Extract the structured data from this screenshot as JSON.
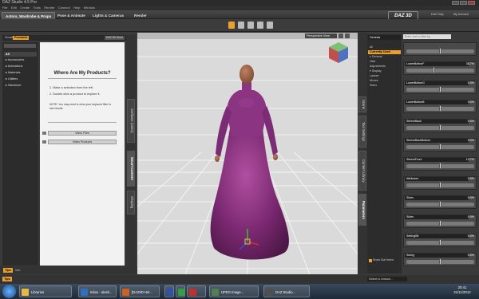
{
  "window": {
    "title": "DAZ Studio 4.5 Pro"
  },
  "menu": [
    "File",
    "Edit",
    "Create",
    "Tools",
    "Render",
    "Connect",
    "Help",
    "Window"
  ],
  "tabs": [
    {
      "label": "Actors, Wardrobe & Props",
      "active": true
    },
    {
      "label": "Pose & Animate",
      "active": false
    },
    {
      "label": "Lights & Cameras",
      "active": false
    },
    {
      "label": "Render",
      "active": false
    }
  ],
  "brand": {
    "logo": "DAZ 3D",
    "links": [
      "DAZ Help",
      "My Account"
    ]
  },
  "left_panel": {
    "tabs": [
      {
        "label": "Smart",
        "active": false
      },
      {
        "label": "Products",
        "active": true
      }
    ],
    "store_button": "DAZ 3D Store",
    "dropdown": "",
    "categories": [
      {
        "label": "All",
        "selected": true
      },
      {
        "label": "▸ Accessories"
      },
      {
        "label": "▸ Animations"
      },
      {
        "label": "▸ Materials"
      },
      {
        "label": "▸ Utilities"
      },
      {
        "label": "▸ Wardrobe"
      }
    ],
    "content": {
      "heading": "Where Are My Products?",
      "step1": "1. Make a selection from the left.",
      "step2": "2. Double-click a product to explore it.",
      "note": "NOTE: You may need to clear your keyword filter to see results.",
      "btn_video_files": "Video Files",
      "btn_video_products": "Video Products"
    },
    "vertical_tabs": [
      "Surfaces (Color)",
      "Smart Content",
      "Shaping"
    ],
    "tips": "Tips",
    "info": "Info"
  },
  "viewport": {
    "perspective": "Perspective View"
  },
  "right_panel": {
    "vertical_tabs": [
      "Scene",
      "Tool Settings",
      "Content Library",
      "Parameters"
    ],
    "header": "Genesis",
    "filter_placeholder": "Enter text to filter by",
    "nav": [
      {
        "label": "All",
        "selected": false
      },
      {
        "label": "Currently Used",
        "selected": true
      },
      {
        "label": "▾ General"
      },
      {
        "label": "  Hide"
      },
      {
        "label": "  Adjustments"
      },
      {
        "label": "▾ Display"
      },
      {
        "label": "  Lasses"
      },
      {
        "label": "  Moves"
      },
      {
        "label": "  Sides"
      }
    ],
    "params": [
      {
        "name": "",
        "value": "",
        "pos": 0.5
      },
      {
        "name": "LowerButtonF",
        "value": "38.7%",
        "pos": 0.4
      },
      {
        "name": "LowerButtonG",
        "value": "0.0%",
        "pos": 0.5
      },
      {
        "name": "LowerButtonB",
        "value": "0.0%",
        "pos": 0.5
      },
      {
        "name": "SleeveBack",
        "value": "0.0%",
        "pos": 0.5
      },
      {
        "name": "SleeveBackBottom",
        "value": "0.0%",
        "pos": 0.5
      },
      {
        "name": "SleeveFront",
        "value": "13.7%",
        "pos": 0.5
      },
      {
        "name": "Attributes",
        "value": "0.0%",
        "pos": 0.5
      },
      {
        "name": "Sides",
        "value": "0.0%",
        "pos": 0.5
      },
      {
        "name": "Sides",
        "value": "0.0%",
        "pos": 0.5
      },
      {
        "name": "SettingBit",
        "value": "0.0%",
        "pos": 0.5
      },
      {
        "name": "Swing",
        "value": "0.0%",
        "pos": 0.5
      }
    ],
    "show_sub_items": "Show Sub Items"
  },
  "statusbar": {
    "lesson": "Select a Lesson..."
  },
  "taskbar": {
    "items": [
      {
        "label": "Libraries",
        "color": "#e8b840"
      },
      {
        "label": "Inbox - alesh...",
        "color": "#3070c0"
      },
      {
        "label": "[DAZ3D Hel...",
        "color": "#d06020"
      },
      {
        "label": "",
        "color": "#3050b0"
      },
      {
        "label": "",
        "color": "#30a040"
      },
      {
        "label": "",
        "color": "#c03030"
      },
      {
        "label": "UPEG Image...",
        "color": "#508050"
      },
      {
        "label": "DAZ Studio...",
        "color": "#505050"
      }
    ],
    "time": "20:41",
    "date": "21/11/2012"
  }
}
